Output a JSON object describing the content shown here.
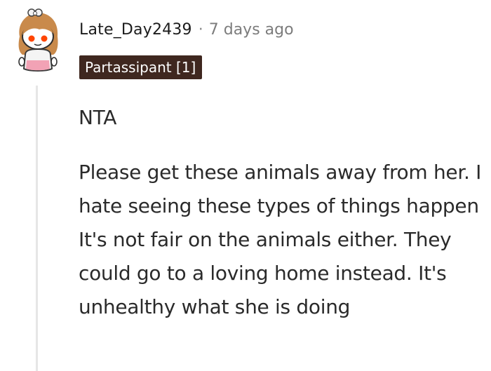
{
  "comment": {
    "author": "Late_Day2439",
    "separator": "·",
    "timestamp": "7 days ago",
    "flair": "Partassipant [1]",
    "paragraphs": [
      "NTA",
      "Please get these animals away from her. I hate seeing these types of things happen It's not fair on the animals either. They could go to a loving home instead. It's unhealthy what she is doing"
    ]
  },
  "icons": {
    "avatar": "snoo-avatar-icon"
  },
  "colors": {
    "flair_background": "#3f271f",
    "flair_text": "#ffffff",
    "thread_line": "#e6e6e6",
    "username": "#1c1c1c",
    "timestamp": "#7c7c7c",
    "body_text": "#2a2a2a"
  }
}
